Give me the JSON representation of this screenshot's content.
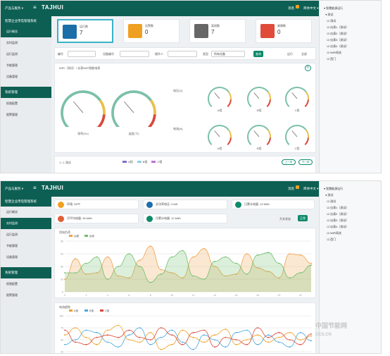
{
  "header": {
    "switch": "产品与服务 ▾",
    "logo": "TAJHUI",
    "messages": "消息",
    "language": "简体中文 ▾",
    "user": "你好, 中国节能示 ▾"
  },
  "sidebar": {
    "system": "智慧企业用电管理系统",
    "items": [
      {
        "label": "运行概览"
      },
      {
        "label": "实时监测"
      },
      {
        "label": "运行监测"
      },
      {
        "label": "节能管理"
      },
      {
        "label": "设备管理"
      }
    ],
    "section": "系统管理",
    "items2": [
      {
        "label": "权限配置"
      },
      {
        "label": "报警管理"
      }
    ]
  },
  "tree": {
    "nodes": [
      "▾ 智慧能源运行",
      "  ▾ 测试",
      "    ☑ 测试",
      "    ☑ 仪表1（测试）",
      "    ☑ 仪表2（测试）",
      "    ☑ 仪表3（测试）",
      "    ☑ 仪表4（测试）",
      "    ☑ WiFi网关",
      "    ☑ 西门"
    ]
  },
  "cards": [
    {
      "title": "运行数",
      "value": "7",
      "color": "#1a6fa8"
    },
    {
      "title": "告警数",
      "value": "0",
      "color": "#f0a020"
    },
    {
      "title": "离线数",
      "value": "7",
      "color": "#666666"
    },
    {
      "title": "故障数",
      "value": "0",
      "color": "#e04b3a"
    }
  ],
  "filters": {
    "f1": "编号",
    "f2": "设备编号",
    "f3": "操作人",
    "f4": "类型",
    "select": "所有设备",
    "btn": "查询",
    "r1": "运行",
    "r2": "全部"
  },
  "gaugePanel": {
    "title": "WiFi（测试）/ 仪表WiFi智能电表",
    "sections": [
      "电压(V)",
      "电流(A)"
    ],
    "big": [
      {
        "label": "频率(Hz)"
      },
      {
        "label": "温度(℃)"
      }
    ],
    "small": [
      "A相",
      "B相",
      "C相",
      "A相",
      "B相",
      "C相"
    ],
    "prev": "上一页",
    "next": "下一页"
  },
  "bottomPanel": {
    "title": "1 / 1 测试",
    "legend": [
      "A相",
      "B相",
      "C相"
    ]
  },
  "stats": [
    {
      "label": "环境: 28℃",
      "color": "#f0a020"
    },
    {
      "label": "总功率电压: 0 kW",
      "color": "#1a6fa8"
    },
    {
      "label": "日累计电量: 10 kWh",
      "color": "#0e8a6c"
    },
    {
      "label": "月平均电量: 30 kWh",
      "color": "#e0603a"
    },
    {
      "label": "月累计电量: 12 kWh",
      "color": "#0e8a6c"
    }
  ],
  "switchLabel": "开关状态",
  "switchValue": "正常",
  "chart1": {
    "title": "用电负荷"
  },
  "chart2": {
    "title": "电流趋势"
  },
  "chart_data": [
    {
      "type": "area",
      "title": "用电负荷",
      "x": [
        "0",
        "1",
        "2",
        "3",
        "4",
        "5",
        "6",
        "7",
        "8",
        "9",
        "10",
        "11",
        "12",
        "13",
        "14",
        "15",
        "16",
        "17",
        "18",
        "19",
        "20",
        "21",
        "22",
        "23"
      ],
      "series": [
        {
          "name": "尖峰",
          "values": [
            20,
            52,
            28,
            30,
            55,
            25,
            22,
            50,
            72,
            35,
            30,
            22,
            55,
            68,
            40,
            25,
            28,
            60,
            38,
            32,
            22,
            60,
            58,
            45
          ]
        },
        {
          "name": "谷段",
          "values": [
            30,
            30,
            45,
            55,
            20,
            40,
            60,
            40,
            15,
            28,
            55,
            65,
            25,
            20,
            48,
            55,
            45,
            28,
            58,
            62,
            45,
            22,
            30,
            42
          ]
        }
      ],
      "ylim": [
        0,
        80
      ]
    },
    {
      "type": "line",
      "title": "电流趋势",
      "x": [
        "0",
        "1",
        "2",
        "3",
        "4",
        "5",
        "6",
        "7",
        "8",
        "9",
        "10",
        "11",
        "12",
        "13",
        "14",
        "15",
        "16",
        "17",
        "18",
        "19",
        "20",
        "21",
        "22",
        "23"
      ],
      "series": [
        {
          "name": "A相",
          "values": [
            60,
            75,
            55,
            40,
            70,
            80,
            50,
            45,
            65,
            30,
            40,
            70,
            55,
            45,
            60,
            72,
            40,
            50,
            60,
            45,
            55,
            65,
            50,
            58
          ]
        },
        {
          "name": "B相",
          "values": [
            40,
            50,
            70,
            65,
            45,
            35,
            60,
            75,
            40,
            55,
            70,
            45,
            30,
            60,
            50,
            35,
            65,
            70,
            40,
            60,
            45,
            35,
            65,
            48
          ]
        },
        {
          "name": "C相",
          "values": [
            70,
            45,
            40,
            55,
            60,
            55,
            70,
            55,
            50,
            75,
            60,
            40,
            65,
            70,
            35,
            55,
            50,
            40,
            75,
            55,
            65,
            50,
            40,
            62
          ]
        }
      ],
      "ylim": [
        0,
        100
      ]
    }
  ]
}
